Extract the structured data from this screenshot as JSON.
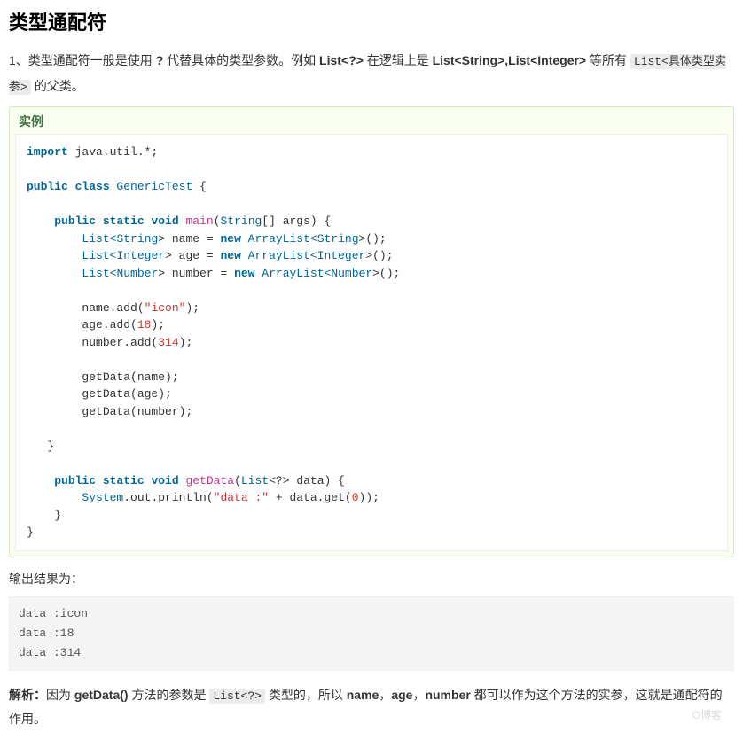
{
  "heading": "类型通配符",
  "intro": {
    "prefix": "1、类型通配符一般是使用 ",
    "q_mark": "?",
    "mid1": " 代替具体的类型参数。例如 ",
    "bold1": "List<?>",
    "mid2": " 在逻辑上是 ",
    "bold2": "List<String>,List<Integer>",
    "mid3": " 等所有 ",
    "codeInline": "List<具体类型实参>",
    "suffix": " 的父类。"
  },
  "exampleTitle": "实例",
  "code": {
    "l1_import": "import",
    "l1_rest": " java.util.*;",
    "l2_public": "public",
    "l2_class": " class",
    "l2_name": " GenericTest ",
    "l2_brace": "{",
    "l3_public": "public",
    "l3_static": " static",
    "l3_void": " void",
    "l3_main": " main",
    "l3a": "(",
    "l3_type": "String",
    "l3_arr": "[] args",
    "l3b": ") {",
    "l4_listopen": "List<",
    "l4_string": "String",
    "l4_close": "> name = ",
    "l4_new": "new",
    "l4_arr": " ArrayList<",
    "l4_string2": "String",
    "l4_end": ">();",
    "l5_listopen": "List<",
    "l5_int": "Integer",
    "l5_close": "> age = ",
    "l5_new": "new",
    "l5_arr": " ArrayList<",
    "l5_int2": "Integer",
    "l5_end": ">();",
    "l6_listopen": "List<",
    "l6_num": "Number",
    "l6_close": "> number = ",
    "l6_new": "new",
    "l6_arr": " ArrayList<",
    "l6_num2": "Number",
    "l6_end": ">();",
    "l7a": "name.add(",
    "l7s": "\"icon\"",
    "l7b": ");",
    "l8a": "age.add(",
    "l8n": "18",
    "l8b": ");",
    "l9a": "number.add(",
    "l9n": "314",
    "l9b": ");",
    "l10": "getData(name);",
    "l11": "getData(age);",
    "l12": "getData(number);",
    "l13": "}",
    "l14_public": "public",
    "l14_static": " static",
    "l14_void": " void",
    "l14_fn": " getData",
    "l14_a": "(",
    "l14_list": "List",
    "l14_b": "<?> data) {",
    "l15_sys": "System",
    "l15_a": ".out.println(",
    "l15_s": "\"data :\"",
    "l15_b": " + data.get(",
    "l15_n": "0",
    "l15_c": "));",
    "l16": "}",
    "l17": "}"
  },
  "outputLabel": "输出结果为：",
  "output": "data :icon\ndata :18\ndata :314",
  "analysis": {
    "prefix": "解析：",
    "t1": "因为 ",
    "b1": "getData()",
    "t2": " 方法的参数是 ",
    "code": "List<?>",
    "t3": " 类型的，所以 ",
    "b2": "name",
    "t4": "，",
    "b3": "age",
    "t5": "，",
    "b4": "number",
    "t6": " 都可以作为这个方法的实参，这就是通配符的作用。"
  },
  "watermark": "O博客"
}
